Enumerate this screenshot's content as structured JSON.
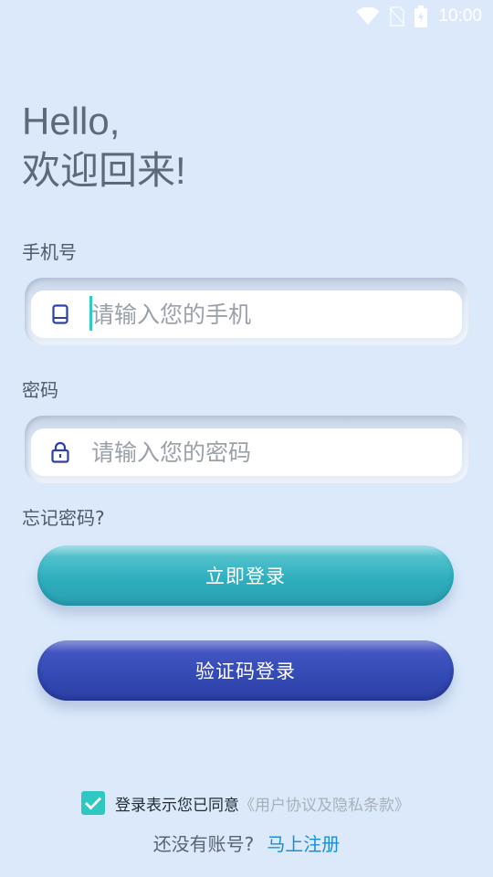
{
  "status_bar": {
    "time": "10:00",
    "icons": [
      "wifi-icon",
      "no-sim-icon",
      "battery-charging-icon"
    ]
  },
  "greeting": {
    "line1": "Hello,",
    "line2": "欢迎回来!"
  },
  "phone": {
    "label": "手机号",
    "placeholder": "请输入您的手机",
    "value": "",
    "icon": "phone-icon"
  },
  "password": {
    "label": "密码",
    "placeholder": "请输入您的密码",
    "value": "",
    "icon": "lock-icon"
  },
  "forgot_label": "忘记密码?",
  "buttons": {
    "login": "立即登录",
    "code_login": "验证码登录"
  },
  "agreement": {
    "checked": true,
    "text": "登录表示您已同意",
    "link": "《用户协议及隐私条款》"
  },
  "register": {
    "prompt": "还没有账号?",
    "link": "马上注册"
  },
  "colors": {
    "background": "#dbe9fb",
    "primary_button": "#2fafbf",
    "secondary_button": "#3349b3",
    "checkbox": "#2fc7c1",
    "link": "#1a8fd6"
  }
}
